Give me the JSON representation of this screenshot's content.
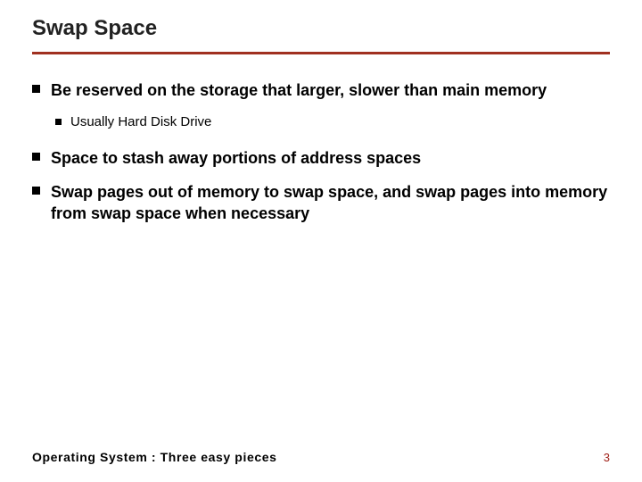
{
  "slide": {
    "title": "Swap Space",
    "bullets": [
      {
        "text": "Be reserved on the storage that larger, slower than main memory",
        "subs": [
          {
            "text": "Usually Hard Disk Drive"
          }
        ]
      },
      {
        "text": "Space to stash away portions of address spaces",
        "subs": []
      },
      {
        "text": "Swap pages out of memory to swap space, and swap pages into memory from swap space when necessary",
        "subs": []
      }
    ],
    "footer_source": "Operating System : Three easy pieces",
    "page_number": "3"
  }
}
